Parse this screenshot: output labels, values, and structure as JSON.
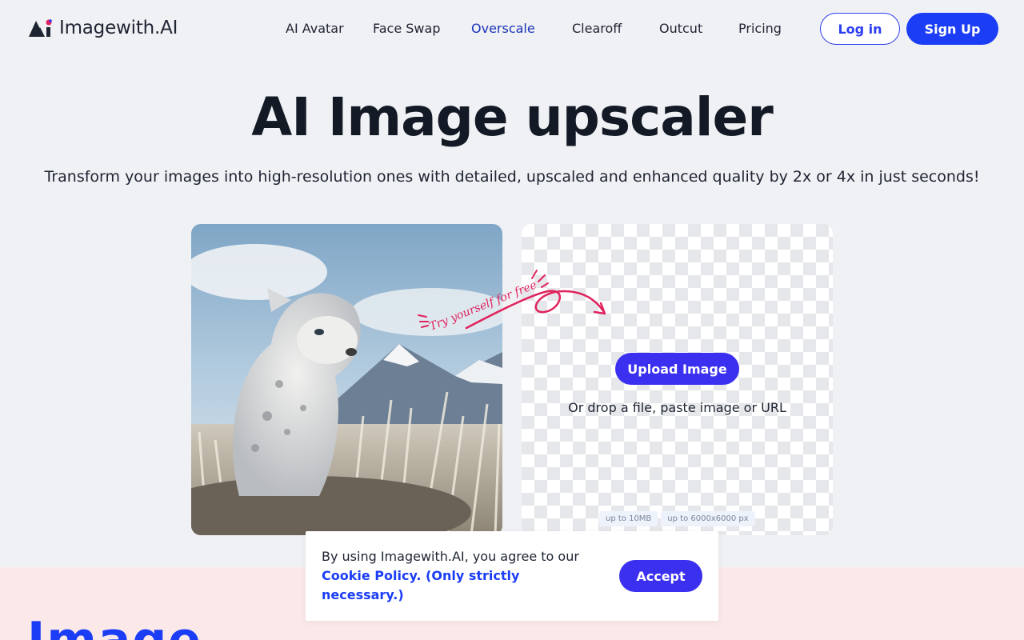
{
  "brand": {
    "name": "Imagewith.AI"
  },
  "nav": {
    "items": [
      {
        "label": "AI Avatar",
        "active": false
      },
      {
        "label": "Face Swap",
        "active": false
      },
      {
        "label": "Overscale",
        "active": true
      },
      {
        "label": "Clearoff",
        "active": false
      },
      {
        "label": "Outcut",
        "active": false
      },
      {
        "label": "Pricing",
        "active": false
      }
    ],
    "login_label": "Log in",
    "signup_label": "Sign Up"
  },
  "hero": {
    "title": "AI Image upscaler",
    "subtitle": "Transform your images into high-resolution ones with detailed, upscaled and enhanced quality by 2x or 4x in just seconds!"
  },
  "sample": {
    "annotation": "Try yourself for free"
  },
  "upload": {
    "button_label": "Upload Image",
    "hint": "Or drop a file, paste image or URL",
    "limits": [
      "up to 10MB",
      "up to 6000x6000 px"
    ]
  },
  "cookie": {
    "text_prefix": "By using Imagewith.AI, you agree to our",
    "link_label": "Cookie Policy. (Only strictly necessary.)",
    "accept_label": "Accept"
  },
  "section": {
    "heading_partial": "Image"
  },
  "colors": {
    "accent": "#1b3df5",
    "upload_button": "#3b2ff0",
    "annotation": "#e0245e",
    "band": "#fbe9ea"
  }
}
